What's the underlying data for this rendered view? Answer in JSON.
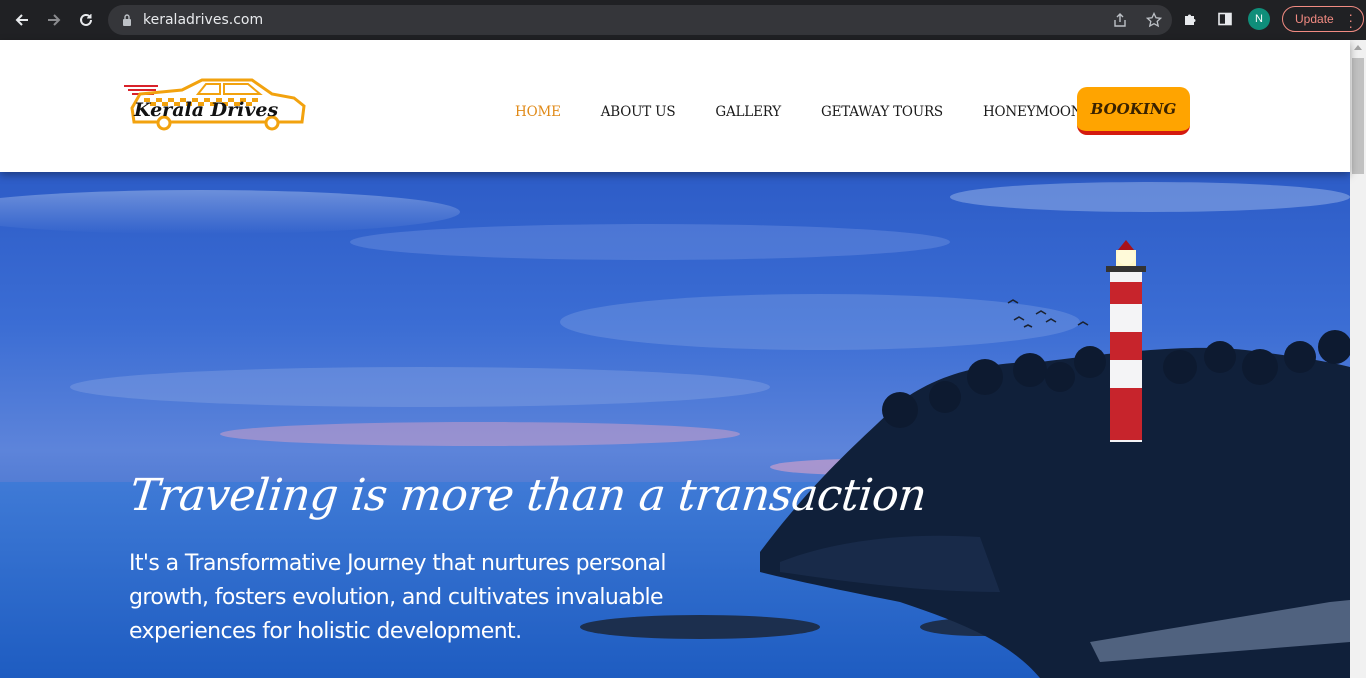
{
  "browser": {
    "url": "keraladrives.com",
    "profile_initial": "N",
    "update_label": "Update"
  },
  "site": {
    "logo_text": "Kerala Drives",
    "menu": [
      {
        "label": "HOME",
        "active": true
      },
      {
        "label": "ABOUT US",
        "active": false
      },
      {
        "label": "GALLERY",
        "active": false
      },
      {
        "label": "GETAWAY TOURS",
        "active": false
      },
      {
        "label": "HONEYMOON",
        "active": false
      }
    ],
    "booking_label": "BOOKING",
    "colors": {
      "accent": "#e08a18",
      "booking_bg": "#ffa400",
      "booking_border": "#d41a0f"
    }
  },
  "hero": {
    "title": "Traveling is more than a transaction",
    "subtitle": "It's a Transformative Journey that nurtures personal growth, fosters evolution, and cultivates invaluable experiences for holistic development."
  }
}
